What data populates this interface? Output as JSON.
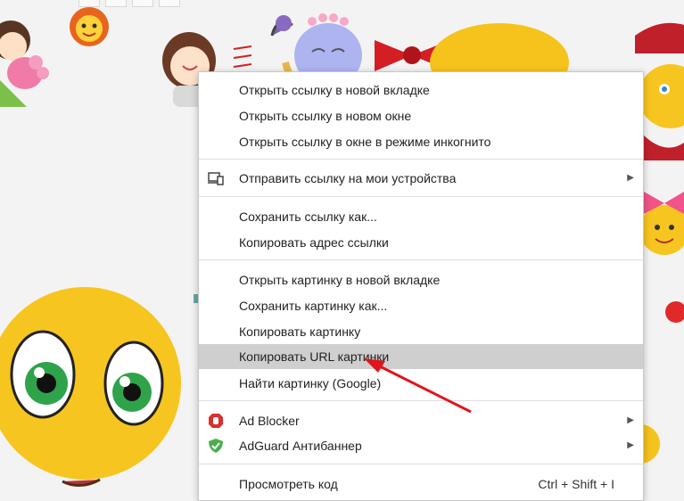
{
  "context_menu": {
    "items": [
      {
        "label": "Открыть ссылку в новой вкладке"
      },
      {
        "label": "Открыть ссылку в новом окне"
      },
      {
        "label": "Открыть ссылку в окне в режиме инкогнито"
      },
      {
        "label": "Отправить ссылку на мои устройства",
        "icon": "devices-icon",
        "submenu": true
      },
      {
        "label": "Сохранить ссылку как..."
      },
      {
        "label": "Копировать адрес ссылки"
      },
      {
        "label": "Открыть картинку в новой вкладке"
      },
      {
        "label": "Сохранить картинку как..."
      },
      {
        "label": "Копировать картинку"
      },
      {
        "label": "Копировать URL картинки",
        "highlighted": true
      },
      {
        "label": "Найти картинку (Google)"
      },
      {
        "label": "Ad Blocker",
        "icon": "adblocker-hand-icon",
        "submenu": true
      },
      {
        "label": "AdGuard Антибаннер",
        "icon": "adguard-shield-icon",
        "submenu": true
      },
      {
        "label": "Просмотреть код",
        "shortcut": "Ctrl + Shift + I"
      }
    ],
    "arrow_glyph": "▶"
  },
  "colors": {
    "highlight": "#cfcfcf",
    "annotation_arrow": "#e0141e",
    "adblocker_red": "#d9302a",
    "adguard_green": "#4aaf4e"
  }
}
